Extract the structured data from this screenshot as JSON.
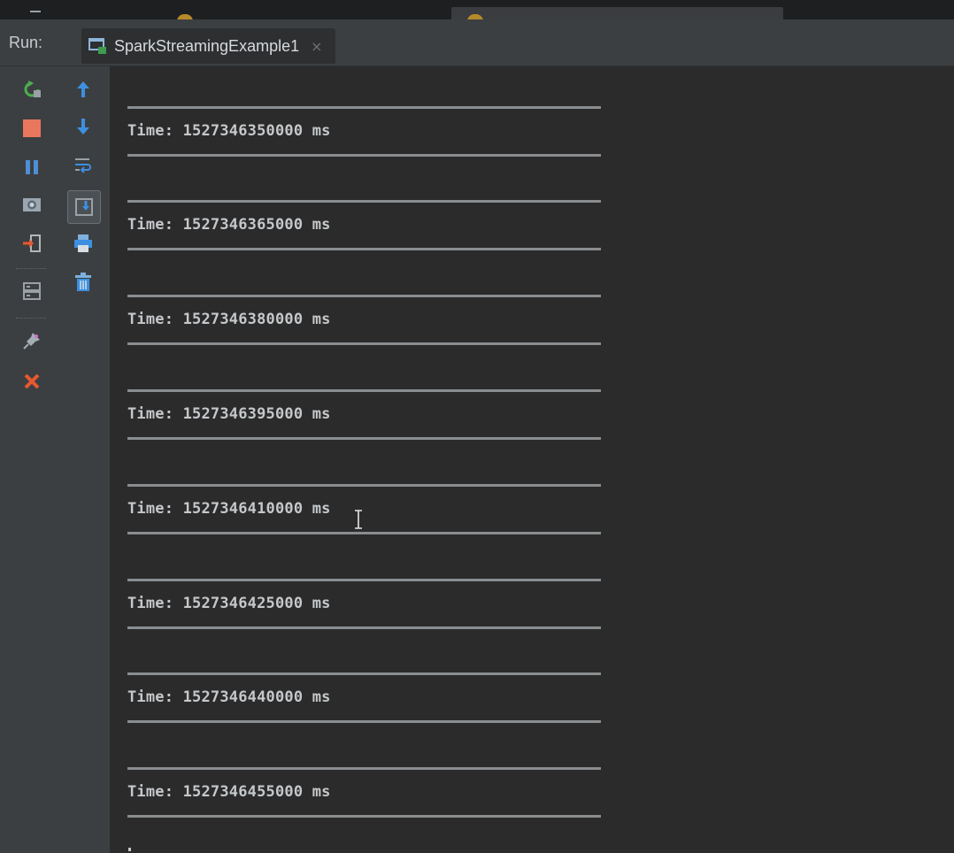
{
  "header": {
    "run_label": "Run:",
    "tab_label": "SparkStreamingExample1",
    "tab_close": "×"
  },
  "console": {
    "lines": [
      "Time: 1527346350000 ms",
      "Time: 1527346365000 ms",
      "Time: 1527346380000 ms",
      "Time: 1527346395000 ms",
      "Time: 1527346410000 ms",
      "Time: 1527346425000 ms",
      "Time: 1527346440000 ms",
      "Time: 1527346455000 ms"
    ]
  },
  "icons": {
    "left_toolbar": [
      "rerun-icon",
      "stop-icon",
      "pause-icon",
      "dump-threads-icon",
      "exit-icon",
      "layout-icon",
      "pin-icon",
      "close-icon"
    ],
    "second_toolbar": [
      "scroll-up-icon",
      "scroll-down-icon",
      "soft-wrap-icon",
      "scroll-to-end-icon",
      "print-icon",
      "clear-all-icon"
    ]
  },
  "colors": {
    "rerun": "#4caf50",
    "stop": "#e8775d",
    "pause": "#4e8fd6",
    "arrow": "#3d8fe0",
    "close": "#e8582f",
    "console_text": "#c5c8cb"
  }
}
